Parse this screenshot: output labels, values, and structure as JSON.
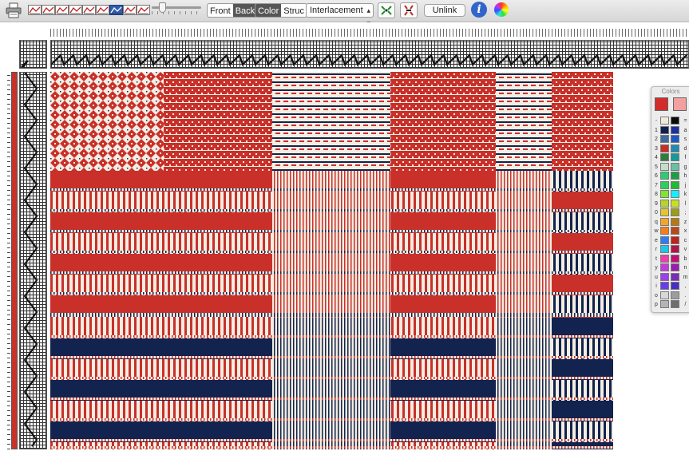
{
  "toolbar": {
    "tools": [
      {
        "name": "tool-1-icon",
        "active": false
      },
      {
        "name": "tool-2-icon",
        "active": false
      },
      {
        "name": "tool-3-icon",
        "active": false
      },
      {
        "name": "tool-4-icon",
        "active": false
      },
      {
        "name": "tool-5-icon",
        "active": false
      },
      {
        "name": "tool-6-icon",
        "active": false
      },
      {
        "name": "tool-7-icon",
        "active": true
      },
      {
        "name": "pencil-tool-icon",
        "active": false
      },
      {
        "name": "tool-9-icon",
        "active": false
      }
    ],
    "front_label": "Front",
    "back_label": "Back",
    "color_label": "Color",
    "struc_label": "Struc",
    "view_selected": "Interlacement",
    "unlink_label": "Unlink",
    "info_label": "i"
  },
  "colors_panel": {
    "title": "Colors",
    "current": "#d22d2a",
    "secondary": "#f2a0a0",
    "palette": [
      {
        "k1": "-",
        "c1": "#f0ead8",
        "c2": "#0a0a0a",
        "k2": "="
      },
      {
        "k1": "1",
        "c1": "#10204e",
        "c2": "#1d2fa2",
        "k2": "a"
      },
      {
        "k1": "2",
        "c1": "#3c6c9c",
        "c2": "#1c58c4",
        "k2": "s"
      },
      {
        "k1": "3",
        "c1": "#c92d25",
        "c2": "#1e8cb0",
        "k2": "d"
      },
      {
        "k1": "4",
        "c1": "#2e7d3a",
        "c2": "#149a9a",
        "k2": "f"
      },
      {
        "k1": "5",
        "c1": "#c2ddc8",
        "c2": "#6cbfa4",
        "k2": "g"
      },
      {
        "k1": "6",
        "c1": "#2ecc71",
        "c2": "#1a9f44",
        "k2": "h"
      },
      {
        "k1": "7",
        "c1": "#29d15c",
        "c2": "#1ebc2e",
        "k2": "j"
      },
      {
        "k1": "8",
        "c1": "#7fe62c",
        "c2": "#12f0ff",
        "k2": "k"
      },
      {
        "k1": "9",
        "c1": "#b5d52a",
        "c2": "#c6e01e",
        "k2": "l"
      },
      {
        "k1": "0",
        "c1": "#e3c52c",
        "c2": "#9e9e14",
        "k2": ";"
      },
      {
        "k1": "q",
        "c1": "#f4a52a",
        "c2": "#b87a10",
        "k2": "z"
      },
      {
        "k1": "w",
        "c1": "#f77d1a",
        "c2": "#b84a18",
        "k2": "x"
      },
      {
        "k1": "e",
        "c1": "#2f7cf0",
        "c2": "#c2201c",
        "k2": "c"
      },
      {
        "k1": "r",
        "c1": "#1dc6e8",
        "c2": "#b0144a",
        "k2": "v"
      },
      {
        "k1": "t",
        "c1": "#f03ca8",
        "c2": "#c21070",
        "k2": "b"
      },
      {
        "k1": "y",
        "c1": "#c23cdc",
        "c2": "#9a1cae",
        "k2": "n"
      },
      {
        "k1": "u",
        "c1": "#9c40ec",
        "c2": "#7a2cb8",
        "k2": "m"
      },
      {
        "k1": "i",
        "c1": "#6a3cec",
        "c2": "#4a2cc8",
        "k2": ","
      },
      {
        "k1": "o",
        "c1": "#d8d8d8",
        "c2": "#9c9c9c",
        "k2": "."
      },
      {
        "k1": "p",
        "c1": "#b4b4b4",
        "c2": "#6e6e6e",
        "k2": "/"
      }
    ]
  },
  "cloth": {
    "colors": {
      "red": "#c9302a",
      "navy": "#12234f",
      "cream": "#f3ede2"
    },
    "columns": [
      {
        "warp": "red",
        "pattern": "a"
      },
      {
        "warp": "red",
        "pattern": "b"
      },
      {
        "warp": "cream",
        "pattern": "c"
      },
      {
        "warp": "cream",
        "pattern": "d"
      },
      {
        "warp": "red",
        "pattern": "b"
      },
      {
        "warp": "cream",
        "pattern": "c"
      },
      {
        "warp": "navy",
        "pattern": "a"
      }
    ],
    "rows": [
      {
        "weft": "red",
        "kind": "motif"
      },
      {
        "weft": "red",
        "kind": "stripe"
      },
      {
        "weft": "navy",
        "kind": "stripe"
      }
    ]
  }
}
